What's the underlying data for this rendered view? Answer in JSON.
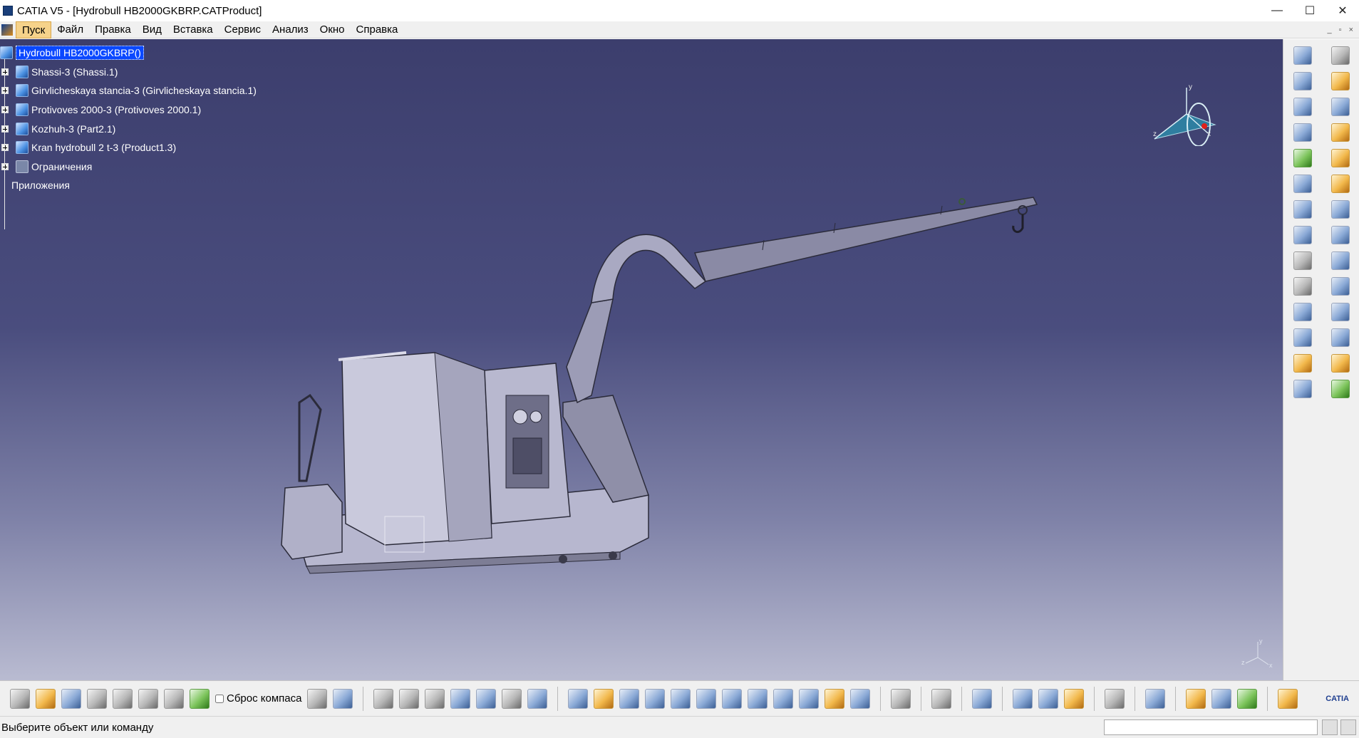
{
  "window": {
    "title": "CATIA V5 - [Hydrobull HB2000GKBRP.CATProduct]",
    "controls": [
      "—",
      "☐",
      "✕"
    ]
  },
  "menu": {
    "items": [
      "Пуск",
      "Файл",
      "Правка",
      "Вид",
      "Вставка",
      "Сервис",
      "Анализ",
      "Окно",
      "Справка"
    ],
    "mdi": [
      "_",
      "▫",
      "×"
    ]
  },
  "tree": {
    "root": "Hydrobull HB2000GKBRP()",
    "children": [
      "Shassi-3 (Shassi.1)",
      "Girvlicheskaya stancia-3 (Girvlicheskaya stancia.1)",
      "Protivoves 2000-3 (Protivoves 2000.1)",
      "Kozhuh-3 (Part2.1)",
      "Kran hydrobull 2 t-3 (Product1.3)",
      "Ограничения"
    ],
    "apps": "Приложения"
  },
  "compass": {
    "x": "x",
    "y": "y",
    "z": "z"
  },
  "toolbar": {
    "reset_compass_label": "Сброс компаса",
    "brand": "CATIA"
  },
  "status": {
    "text": "Выберите объект или команду",
    "input_value": ""
  },
  "colors": {
    "viewport_top": "#3c3e6d",
    "viewport_bottom": "#b9bbd1",
    "selection": "#0a48ff",
    "menu_active": "#f6d28a"
  }
}
